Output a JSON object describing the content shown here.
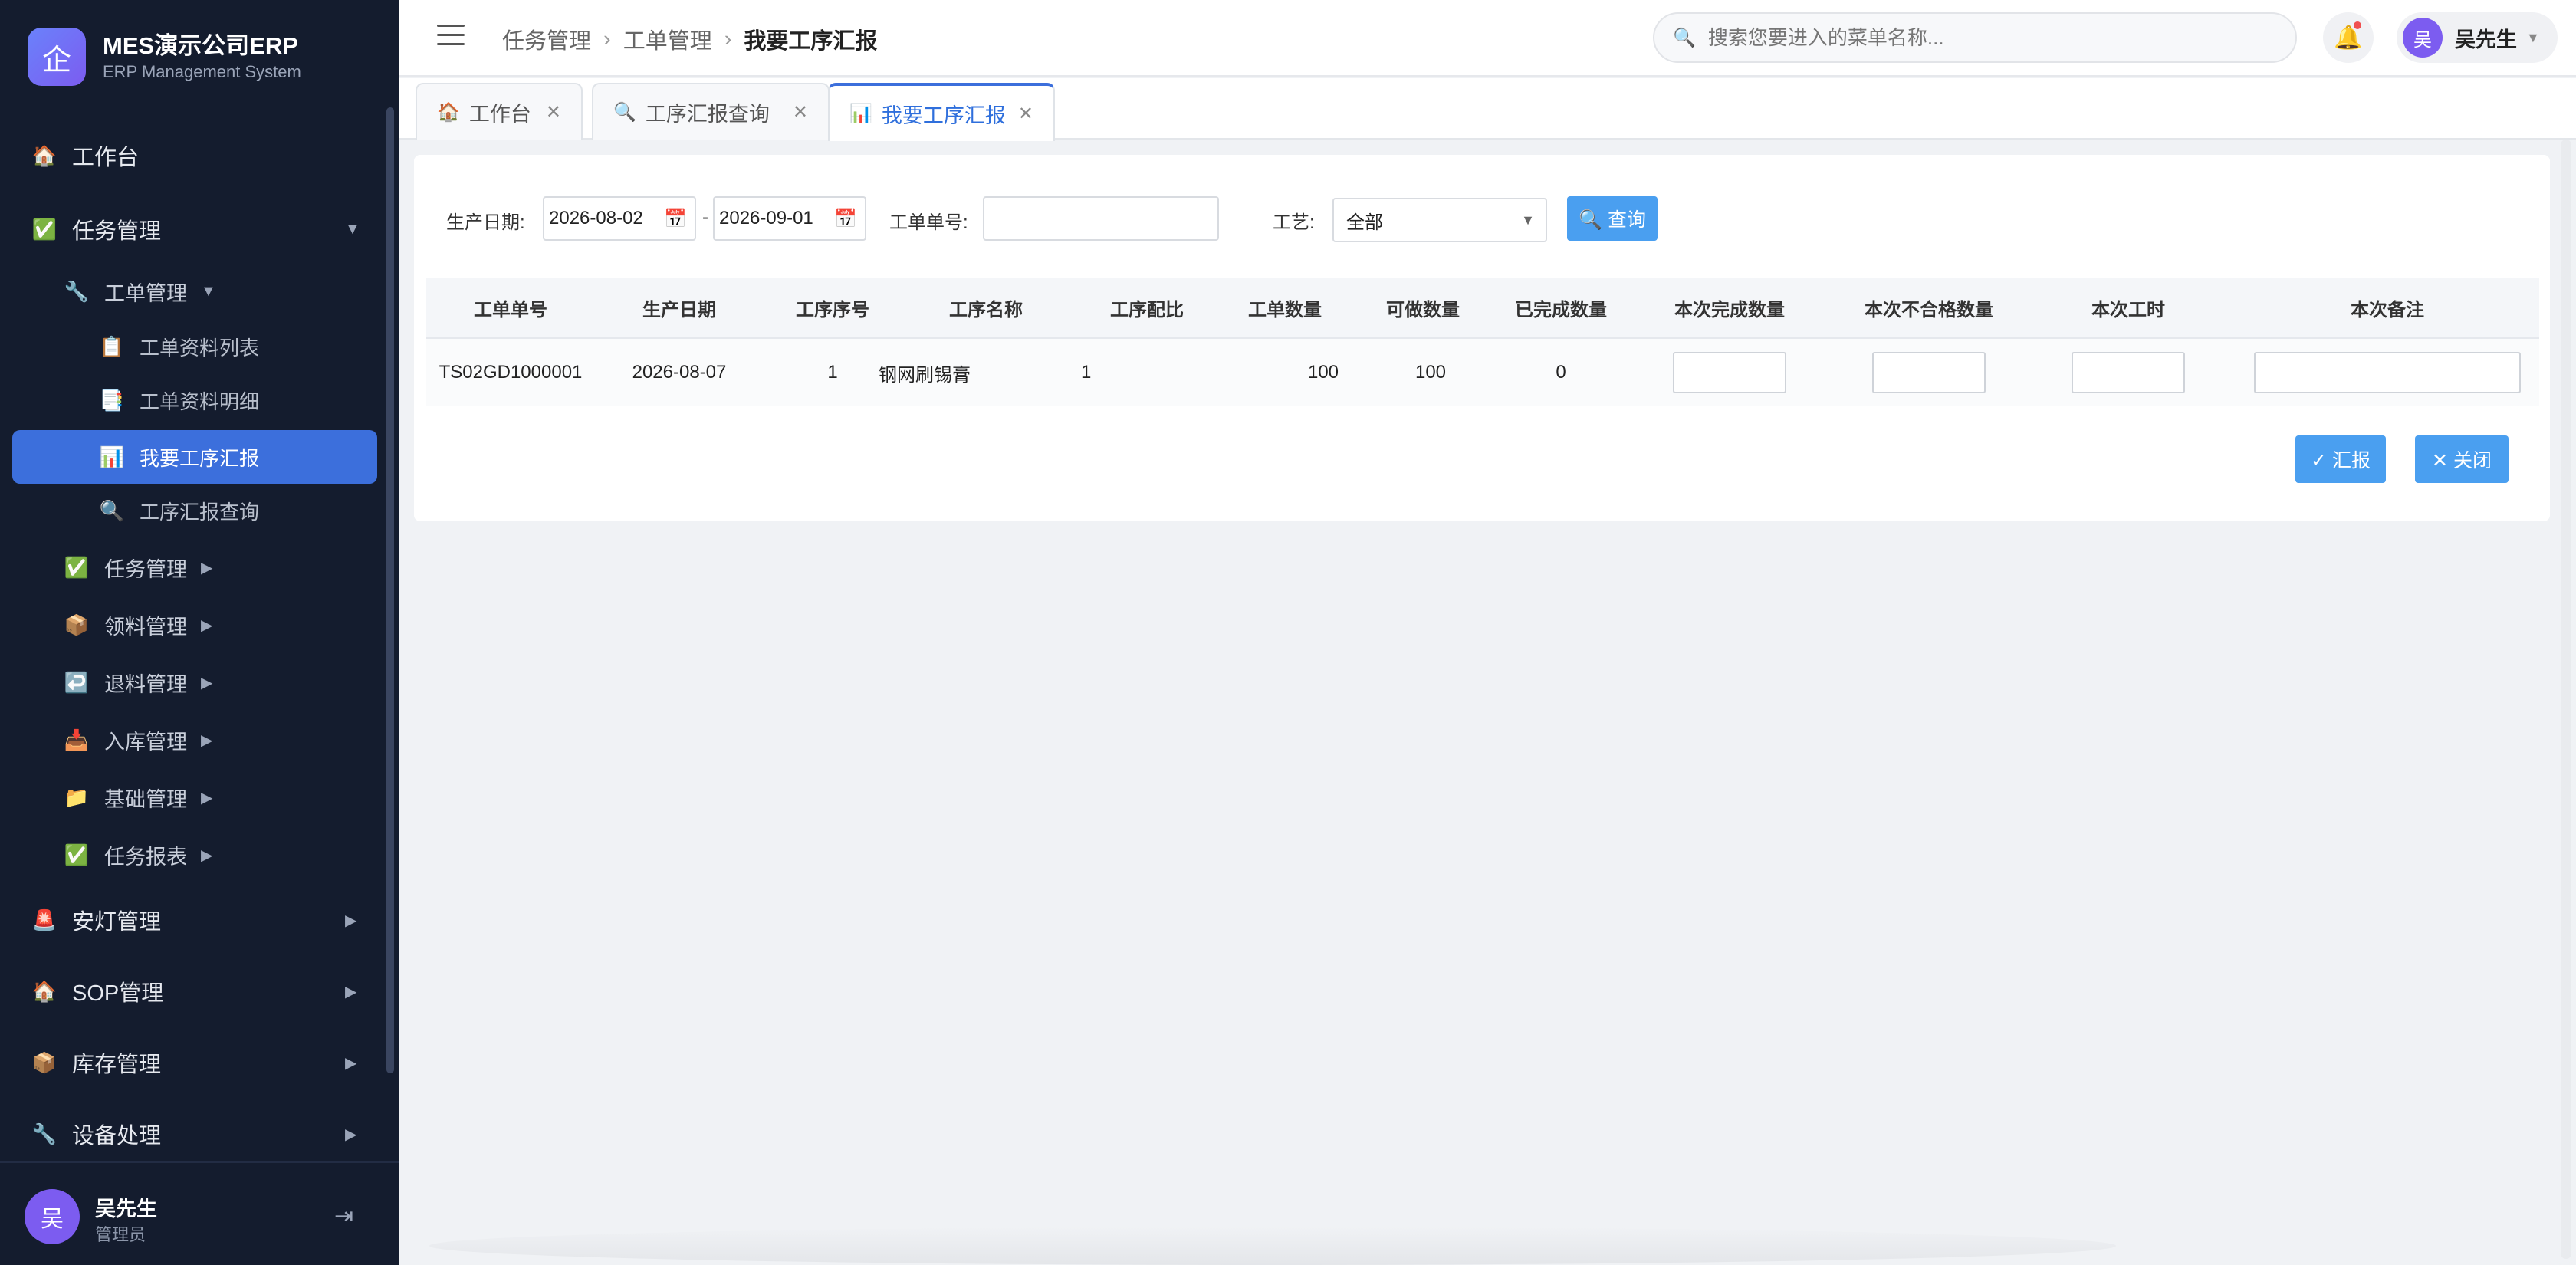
{
  "brand": {
    "logo_char": "企",
    "title": "MES演示公司ERP",
    "subtitle": "ERP Management System"
  },
  "sidebar": {
    "items": [
      {
        "icon": "🏠",
        "label": "工作台"
      },
      {
        "icon": "✅",
        "label": "任务管理",
        "arrow": "▼"
      },
      {
        "icon": "🔧",
        "label": "工单管理",
        "arrow": "▼"
      },
      {
        "icon": "📋",
        "label": "工单资料列表"
      },
      {
        "icon": "📑",
        "label": "工单资料明细"
      },
      {
        "icon": "📊",
        "label": "我要工序汇报"
      },
      {
        "icon": "🔍",
        "label": "工序汇报查询"
      },
      {
        "icon": "✅",
        "label": "任务管理",
        "arrow": "▶"
      },
      {
        "icon": "📦",
        "label": "领料管理",
        "arrow": "▶"
      },
      {
        "icon": "↩️",
        "label": "退料管理",
        "arrow": "▶"
      },
      {
        "icon": "📥",
        "label": "入库管理",
        "arrow": "▶"
      },
      {
        "icon": "📁",
        "label": "基础管理",
        "arrow": "▶"
      },
      {
        "icon": "✅",
        "label": "任务报表",
        "arrow": "▶"
      },
      {
        "icon": "🚨",
        "label": "安灯管理",
        "arrow": "▶"
      },
      {
        "icon": "🏠",
        "label": "SOP管理",
        "arrow": "▶"
      },
      {
        "icon": "📦",
        "label": "库存管理",
        "arrow": "▶"
      },
      {
        "icon": "🔧",
        "label": "设备处理",
        "arrow": "▶"
      }
    ],
    "user": {
      "avatar": "吴",
      "name": "吴先生",
      "role": "管理员",
      "logout_icon": "⇥"
    }
  },
  "header": {
    "breadcrumb": [
      "任务管理",
      "工单管理",
      "我要工序汇报"
    ],
    "separator": "›",
    "search_placeholder": "搜索您要进入的菜单名称...",
    "search_icon": "🔍",
    "bell_icon": "🔔",
    "user": {
      "avatar": "吴",
      "name": "吴先生",
      "caret": "▼"
    }
  },
  "tabs": [
    {
      "icon": "🏠",
      "label": "工作台",
      "close": "✕"
    },
    {
      "icon": "🔍",
      "label": "工序汇报查询",
      "close": "✕"
    },
    {
      "icon": "📊",
      "label": "我要工序汇报",
      "close": "✕",
      "active": true
    }
  ],
  "filters": {
    "date_label": "生产日期:",
    "date_from": "2026-08-02",
    "date_to": "2026-09-01",
    "date_sep": "-",
    "calendar_icon": "📅",
    "order_label": "工单单号:",
    "order_value": "",
    "process_label": "工艺:",
    "process_value": "全部",
    "query_button": "🔍 查询"
  },
  "table": {
    "headers": [
      "工单单号",
      "生产日期",
      "工序序号",
      "工序名称",
      "工序配比",
      "工单数量",
      "可做数量",
      "已完成数量",
      "本次完成数量",
      "本次不合格数量",
      "本次工时",
      "本次备注"
    ],
    "rows": [
      {
        "order_no": "TS02GD1000001",
        "date": "2026-08-07",
        "seq": "1",
        "name": "钢网刷锡膏",
        "ratio": "1",
        "qty": "100",
        "available": "100",
        "done": "0"
      }
    ]
  },
  "actions": {
    "report": "✓ 汇报",
    "close": "✕ 关闭"
  }
}
